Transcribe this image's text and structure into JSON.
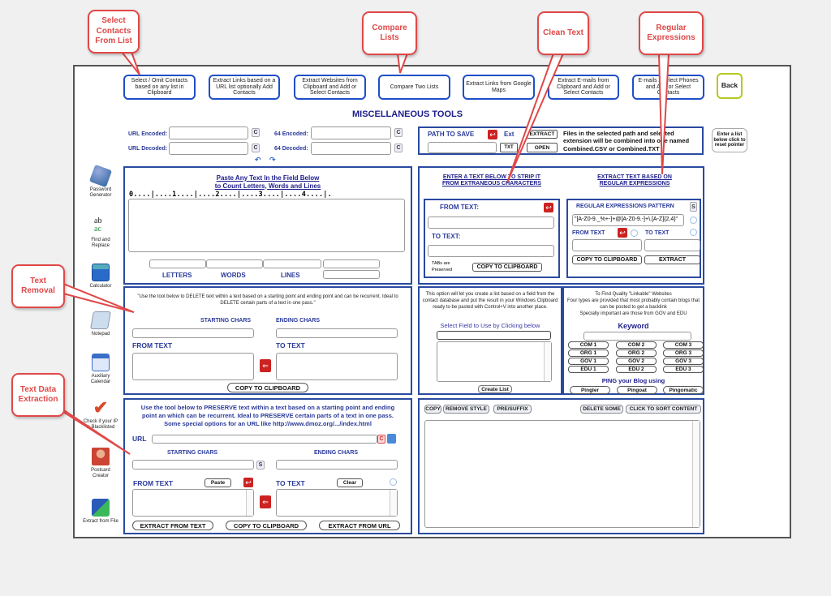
{
  "callouts": [
    {
      "id": "select-contacts",
      "text": "Select Contacts From List"
    },
    {
      "id": "compare-lists",
      "text": "Compare Lists"
    },
    {
      "id": "clean-text",
      "text": "Clean Text"
    },
    {
      "id": "regular-expressions",
      "text": "Regular Expressions"
    },
    {
      "id": "text-removal",
      "text": "Text Removal"
    },
    {
      "id": "text-data-extraction",
      "text": "Text Data Extraction"
    }
  ],
  "nav": [
    "Select / Omit Contacts based on any list in Clipboard",
    "Extract Links based on a URL list optionally Add Contacts",
    "Extract Websites from Clipboard and Add or Select Contacts",
    "Compare Two Lists",
    "Extract Links from Google Maps",
    "Extract E-mails from Clipboard and Add or Select Contacts",
    "E-mails / Select Phones and Add or Select Contacts"
  ],
  "back_label": "Back",
  "page_title": "MISCELLANEOUS TOOLS",
  "encode": {
    "url_encoded": "URL Encoded:",
    "url_decoded": "URL Decoded:",
    "b64_encoded": "64 Encoded:",
    "b64_decoded": "64 Decoded:",
    "clear": "C"
  },
  "path": {
    "label": "PATH TO SAVE",
    "ext": "Ext",
    "extract": "EXTRACT",
    "txt": "TXT",
    "open": "OPEN",
    "info": "Files in the selected path and selected extension will be combined into one named Combined.CSV or Combined.TXT"
  },
  "reset_pointer": "Enter a list below click to reset pointer",
  "sidebar": [
    {
      "label": "Password Generator",
      "icon": "dice-icon"
    },
    {
      "label": "Find and Replace",
      "icon": "find-replace-icon"
    },
    {
      "label": "Calculator",
      "icon": "calculator-icon"
    },
    {
      "label": "Notepad",
      "icon": "notepad-icon"
    },
    {
      "label": "Auxiliary Calendar",
      "icon": "calendar-icon"
    },
    {
      "label": "Check if your IP is Blacklisted",
      "icon": "checkmark-icon"
    },
    {
      "label": "Postcard Creator",
      "icon": "person-icon"
    },
    {
      "label": "Extract from File",
      "icon": "extract-file-icon"
    }
  ],
  "counter": {
    "title1": "Paste Any Text In the Field Below",
    "title2": "to Count Letters, Words and Lines",
    "ruler": "0....|....1....|....2....|....3....|....4....|.",
    "letters": "LETTERS",
    "words": "WORDS",
    "lines": "LINES"
  },
  "clean": {
    "title1": "ENTER A TEXT BELOW TO STRIP IT",
    "title2": "FROM EXTRANEOUS CHARACTERS",
    "from": "FROM TEXT:",
    "to": "TO TEXT:",
    "tabs_note": "TABs are Preserved",
    "copy": "COPY TO CLIPBOARD"
  },
  "regex": {
    "title1": "EXTRACT TEXT BASED ON",
    "title2": "REGULAR EXPRESSIONS",
    "pattern_label": "REGULAR EXPRESSIONS PATTERN",
    "s": "S",
    "pattern_value": "\"[A-Z0-9._%+-]+@[A-Z0-9.-]+\\.[A-Z]{2,4}\"",
    "from": "FROM TEXT",
    "to": "TO TEXT",
    "copy": "COPY TO CLIPBOARD",
    "extract": "EXTRACT"
  },
  "removal": {
    "desc": "\"Use the tool below to DELETE text within a text based on a starting point and ending point and can be recurrent. Ideal to DELETE certain parts of a text  in one pass.\"",
    "starting": "STARTING CHARS",
    "ending": "ENDING CHARS",
    "from": "FROM TEXT",
    "to": "TO TEXT",
    "copy": "COPY TO CLIPBOARD"
  },
  "listcreate": {
    "desc": "This option will let you create a list based on a field from the contact database and put the result in your Windows Clipboard ready to be pasted with Control+V into another place.",
    "select": "Select Field to Use by Clicking below",
    "create": "Create List"
  },
  "linkable": {
    "desc1": "To Find Quality \"Linkable\" Websites",
    "desc2": "Four types are provided that most probably contain blogs that can be posted to get a backlink",
    "desc3": "Specially important are those from GOV and EDU",
    "keyword": "Keyword",
    "buttons": [
      "COM 1",
      "COM 2",
      "COM 3",
      "ORG 1",
      "ORG 2",
      "ORG 3",
      "GOV 1",
      "GOV 2",
      "GOV 3",
      "EDU 1",
      "EDU 2",
      "EDU 3"
    ],
    "ping_label": "PING your Blog using",
    "ping": [
      "Pingler",
      "Pingoat",
      "Pingomatic"
    ]
  },
  "extraction": {
    "desc1": "Use the tool below to PRESERVE text within a text based on a starting point and ending",
    "desc2": "point an which can be recurrent. Ideal to PRESERVE certain parts of a text  in one pass.",
    "desc3": "Some special options for an URL like http://www.dmoz.org/.../index.html",
    "url": "URL",
    "c": "C",
    "starting": "STARTING CHARS",
    "ending": "ENDING CHARS",
    "s": "S",
    "from": "FROM TEXT",
    "paste": "Paste",
    "to": "TO TEXT",
    "clear": "Clear",
    "extract_text": "EXTRACT FROM TEXT",
    "copy": "COPY TO CLIPBOARD",
    "extract_url": "EXTRACT FROM URL"
  },
  "output": {
    "copy": "COPY",
    "remove_style": "REMOVE STYLE",
    "pre_suffix": "PRE/SUFFIX",
    "delete_some": "DELETE SOME",
    "sort": "CLICK TO SORT CONTENT"
  }
}
